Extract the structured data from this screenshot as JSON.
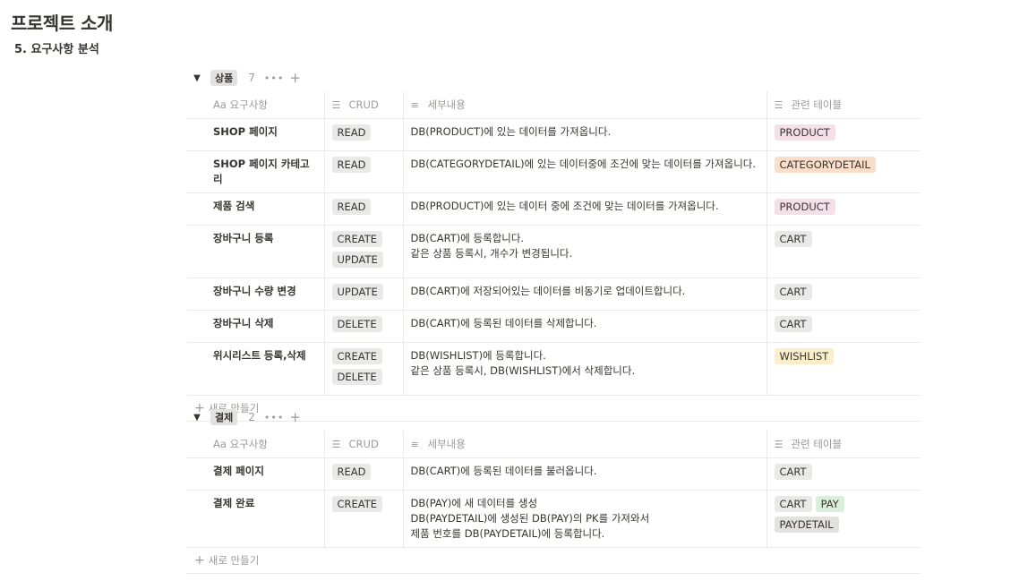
{
  "page": {
    "title": "프로젝트 소개",
    "subtitle": "5. 요구사항 분석"
  },
  "headers": {
    "name": "Aa 요구사항",
    "crud": "CRUD",
    "detail": "세부내용",
    "tables": "관련 테이블",
    "crud_icon": "☰",
    "detail_icon": "≡",
    "tables_icon": "☰"
  },
  "new_row_label": "새로 만들기",
  "groups": [
    {
      "label": "상품",
      "count": "7",
      "rows": [
        {
          "name": "SHOP 페이지",
          "crud": [
            "READ"
          ],
          "detail": [
            "DB(PRODUCT)에 있는 데이터를 가져옵니다."
          ],
          "tables": [
            {
              "label": "PRODUCT",
              "color": "#f5e0e9"
            }
          ]
        },
        {
          "name": "SHOP 페이지 카테고리",
          "crud": [
            "READ"
          ],
          "detail": [
            "DB(CATEGORYDETAIL)에 있는 데이터중에 조건에 맞는 데이터를 가져옵니다."
          ],
          "tables": [
            {
              "label": "CATEGORYDETAIL",
              "color": "#fadec9"
            }
          ]
        },
        {
          "name": "제품 검색",
          "crud": [
            "READ"
          ],
          "detail": [
            "DB(PRODUCT)에 있는 데이터 중에 조건에 맞는 데이터를 가져옵니다."
          ],
          "tables": [
            {
              "label": "PRODUCT",
              "color": "#f5e0e9"
            }
          ]
        },
        {
          "name": "장바구니 등록",
          "crud": [
            "CREATE",
            "UPDATE"
          ],
          "detail": [
            "DB(CART)에 등록합니다.",
            "같은 상품 등록시, 개수가 변경됩니다."
          ],
          "tables": [
            {
              "label": "CART",
              "color": "#e9e9e7"
            }
          ]
        },
        {
          "name": "장바구니 수량 변경",
          "crud": [
            "UPDATE"
          ],
          "detail": [
            "DB(CART)에 저장되어있는 데이터를 비동기로 업데이트합니다."
          ],
          "tables": [
            {
              "label": "CART",
              "color": "#e9e9e7"
            }
          ]
        },
        {
          "name": "장바구니 삭제",
          "crud": [
            "DELETE"
          ],
          "detail": [
            "DB(CART)에 등록된 데이터를 삭제합니다."
          ],
          "tables": [
            {
              "label": "CART",
              "color": "#e9e9e7"
            }
          ]
        },
        {
          "name": "위시리스트 등록,삭제",
          "crud": [
            "CREATE",
            "DELETE"
          ],
          "detail": [
            "DB(WISHLIST)에 등록합니다.",
            "같은 상품 등록시, DB(WISHLIST)에서 삭제합니다."
          ],
          "tables": [
            {
              "label": "WISHLIST",
              "color": "#fbeecc"
            }
          ]
        }
      ]
    },
    {
      "label": "결제",
      "count": "2",
      "rows": [
        {
          "name": "결제 페이지",
          "crud": [
            "READ"
          ],
          "detail": [
            "DB(CART)에 등록된 데이터를 불러옵니다."
          ],
          "tables": [
            {
              "label": "CART",
              "color": "#e9e9e7"
            }
          ]
        },
        {
          "name": "결제 완료",
          "crud": [
            "CREATE"
          ],
          "detail": [
            "DB(PAY)에 새 데이터를 생성",
            "DB(PAYDETAIL)에 생성된 DB(PAY)의 PK를 가져와서",
            "제품 번호를 DB(PAYDETAIL)에 등록합니다."
          ],
          "tables": [
            {
              "label": "CART",
              "color": "#e9e9e7"
            },
            {
              "label": "PAY",
              "color": "#dbeddb"
            },
            {
              "label": "PAYDETAIL",
              "color": "#e3e2e0"
            }
          ]
        }
      ]
    }
  ]
}
